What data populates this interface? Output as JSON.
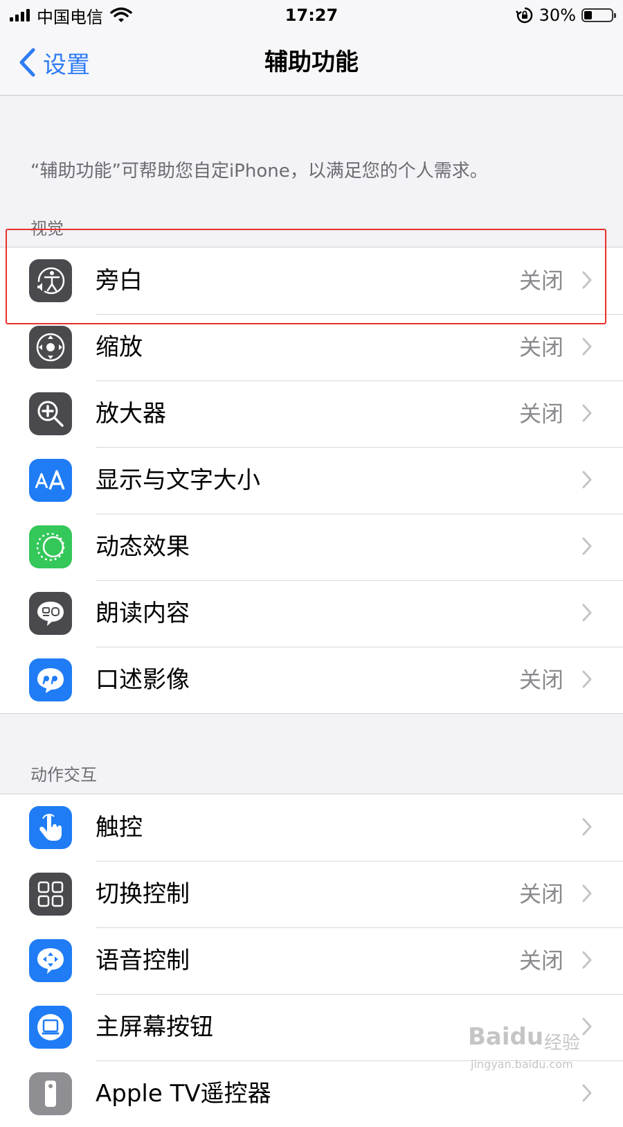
{
  "status_bar": {
    "carrier": "中国电信",
    "time": "17:27",
    "battery_percent": "30%",
    "battery_level": 0.3
  },
  "nav": {
    "back_label": "设置",
    "title": "辅助功能"
  },
  "intro_text": "“辅助功能”可帮助您自定iPhone，以满足您的个人需求。",
  "sections": [
    {
      "header": "视觉",
      "items": [
        {
          "label": "旁白",
          "value": "关闭",
          "icon": "voiceover-icon",
          "icon_bg": "#4a4a4e"
        },
        {
          "label": "缩放",
          "value": "关闭",
          "icon": "zoom-icon",
          "icon_bg": "#4a4a4e"
        },
        {
          "label": "放大器",
          "value": "关闭",
          "icon": "magnifier-icon",
          "icon_bg": "#4a4a4e"
        },
        {
          "label": "显示与文字大小",
          "value": "",
          "icon": "text-size-icon",
          "icon_bg": "#1f7cf5"
        },
        {
          "label": "动态效果",
          "value": "",
          "icon": "motion-icon",
          "icon_bg": "#34c759"
        },
        {
          "label": "朗读内容",
          "value": "",
          "icon": "spoken-content-icon",
          "icon_bg": "#4a4a4e"
        },
        {
          "label": "口述影像",
          "value": "关闭",
          "icon": "audio-descriptions-icon",
          "icon_bg": "#1f7cf5"
        }
      ]
    },
    {
      "header": "动作交互",
      "items": [
        {
          "label": "触控",
          "value": "",
          "icon": "touch-icon",
          "icon_bg": "#1f7cf5"
        },
        {
          "label": "切换控制",
          "value": "关闭",
          "icon": "switch-control-icon",
          "icon_bg": "#4a4a4e"
        },
        {
          "label": "语音控制",
          "value": "关闭",
          "icon": "voice-control-icon",
          "icon_bg": "#1f7cf5"
        },
        {
          "label": "主屏幕按钮",
          "value": "",
          "icon": "home-button-icon",
          "icon_bg": "#1f7cf5"
        },
        {
          "label": "Apple TV遥控器",
          "value": "",
          "icon": "apple-tv-remote-icon",
          "icon_bg": "#8e8e93"
        }
      ]
    }
  ],
  "watermark": {
    "logo": "Baidu",
    "cn": "经验",
    "url": "jingyan.baidu.com"
  },
  "colors": {
    "accent": "#2f7cf6",
    "highlight": "#e8312a",
    "background": "#f2f2f7"
  }
}
